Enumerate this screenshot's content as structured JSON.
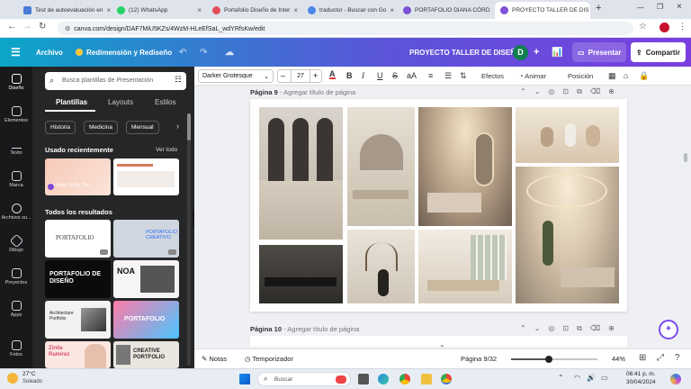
{
  "browser": {
    "tabs": [
      {
        "title": "Test de autoevaluación en",
        "color": "#4a7bd8"
      },
      {
        "title": "(12) WhatsApp",
        "color": "#25d366"
      },
      {
        "title": "Portafolio Diseño de Inter",
        "color": "#e34d5b"
      },
      {
        "title": "traductor - Buscar con Go",
        "color": "#4a86e8"
      },
      {
        "title": "PORTAFOLIO DIANA CÓRD",
        "color": "#7d52d6"
      },
      {
        "title": "PROYECTO TALLER DE DIS",
        "color": "#7d52d6"
      }
    ],
    "new_tab": "+",
    "url": "canva.com/design/DAF7MiU5KZs/4WzM-HLeEfSaL_wdYRfsKw/edit"
  },
  "header": {
    "menu_icon": "hamburger-icon",
    "archivo": "Archivo",
    "resize": "Redimensión y Rediseño",
    "project_title": "PROYECTO TALLER DE DISEÑO",
    "avatar": "D",
    "present": "Presentar",
    "share": "Compartir"
  },
  "rail": [
    {
      "label": "Diseño",
      "icon": "layout-icon"
    },
    {
      "label": "Elementos",
      "icon": "shapes-icon"
    },
    {
      "label": "Texto",
      "icon": "text-icon"
    },
    {
      "label": "Marca",
      "icon": "brand-icon"
    },
    {
      "label": "Archivos su...",
      "icon": "upload-icon"
    },
    {
      "label": "Dibujo",
      "icon": "draw-icon"
    },
    {
      "label": "Proyectos",
      "icon": "folder-icon"
    },
    {
      "label": "Apps",
      "icon": "apps-icon"
    },
    {
      "label": "Fotos",
      "icon": "photo-icon"
    }
  ],
  "panel": {
    "search_placeholder": "Busca plantillas de Presentación",
    "tabs": [
      "Plantillas",
      "Estilos",
      "Layouts"
    ],
    "chips": [
      "Historia",
      "Medicina",
      "Mensual"
    ],
    "recent_title": "Usado recientemente",
    "see_all": "Ver todo",
    "recent_thumb_text": "We Work To Do The",
    "results_title": "Todos los resultados",
    "results": [
      {
        "text": "PORTAFOLIO",
        "bg": "#ffffff",
        "fg": "#444444"
      },
      {
        "text": "PORTAFOLIO CREATIVO",
        "bg": "#cfd6df",
        "fg": "#2f6bff"
      },
      {
        "text": "PORTAFOLIO DE DISEÑO",
        "bg": "#0b0b0b",
        "fg": "#ffffff"
      },
      {
        "text": "NOA",
        "bg": "#f5f5f5",
        "fg": "#111111"
      },
      {
        "text": "Architecture Portfolio",
        "bg": "#f2f2f2",
        "fg": "#222222"
      },
      {
        "text": "PORTAFOLIO",
        "bg": "#ff7aa8",
        "fg": "#ffffff"
      },
      {
        "text": "Zinlla Ramírez",
        "bg": "#fbe7e0",
        "fg": "#d84c78"
      },
      {
        "text": "CREATIVE PORTFOLIO",
        "bg": "#e9e6df",
        "fg": "#222222"
      }
    ]
  },
  "toolbar": {
    "font": "Darker Grotesque",
    "font_size": "27",
    "minus": "–",
    "plus": "+",
    "bold": "B",
    "italic": "I",
    "underline": "U",
    "strike": "S",
    "case": "aA",
    "effects": "Efectos",
    "animate": "Animar",
    "position": "Posición"
  },
  "pages": [
    {
      "label": "Página 9",
      "subtitle": "- Agregar título de página"
    },
    {
      "label": "Página 10",
      "subtitle": "- Agregar título de página"
    }
  ],
  "footer": {
    "notes": "Notas",
    "timer": "Temporizador",
    "page_indicator": "Página 9/32",
    "zoom": "44%",
    "zoom_level": 0.44
  },
  "taskbar": {
    "temperature": "27°C",
    "weather": "Soleado",
    "search_placeholder": "Buscar",
    "time": "06:41 p. m.",
    "date": "30/04/2024"
  }
}
